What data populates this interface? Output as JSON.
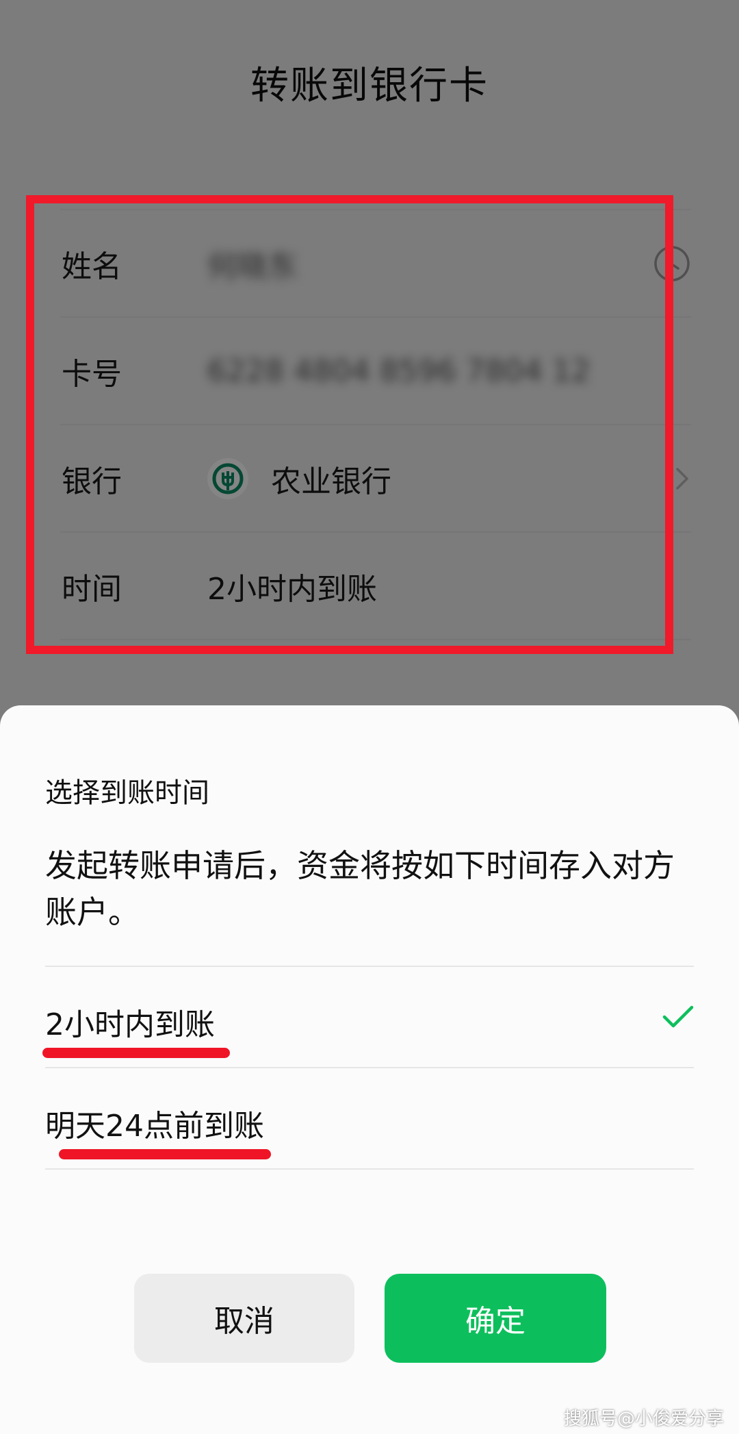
{
  "page": {
    "title": "转账到银行卡",
    "form": [
      {
        "label": "姓名",
        "value": "何晓东",
        "blurred": true,
        "icon": "clock-icon"
      },
      {
        "label": "卡号",
        "value": "6228 4804 8596 7804 12",
        "blurred": true
      },
      {
        "label": "银行",
        "value": "农业银行",
        "icon": "abc-bank-logo"
      },
      {
        "label": "时间",
        "value": "2小时内到账"
      }
    ]
  },
  "sheet": {
    "title": "选择到账时间",
    "description": "发起转账申请后，资金将按如下时间存入对方账户。",
    "options": [
      {
        "label": "2小时内到账",
        "selected": true
      },
      {
        "label": "明天24点前到账",
        "selected": false
      }
    ],
    "cancel_label": "取消",
    "confirm_label": "确定"
  },
  "colors": {
    "accent_green": "#0dbf5c",
    "highlight_red": "#f01a2a",
    "bank_green": "#0a8a63"
  },
  "watermark": "搜狐号@小俊爱分享"
}
